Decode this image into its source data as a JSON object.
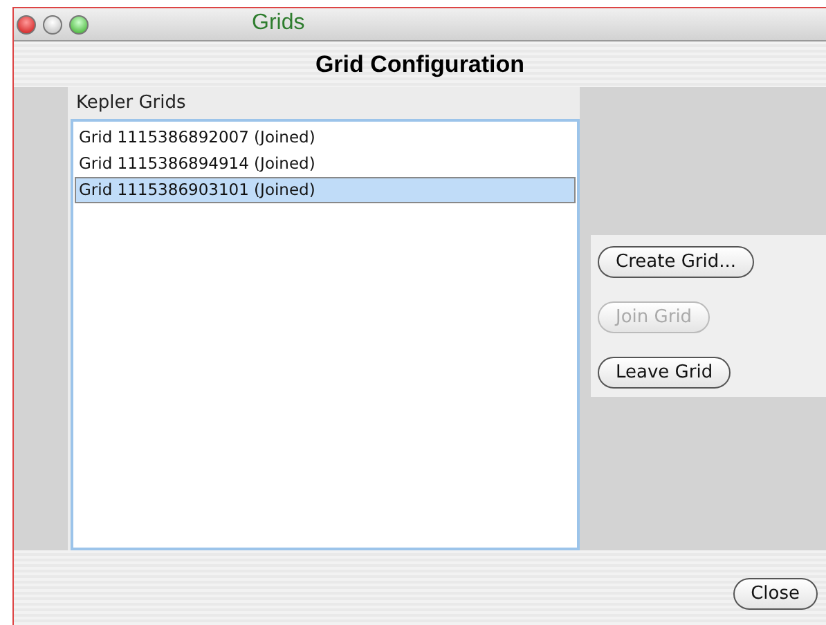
{
  "background_text": "Grids",
  "window": {
    "title": "Grid Configuration"
  },
  "list": {
    "heading": "Kepler Grids",
    "items": [
      {
        "label": "Grid 1115386892007 (Joined)",
        "selected": false
      },
      {
        "label": "Grid 1115386894914 (Joined)",
        "selected": false
      },
      {
        "label": "Grid 1115386903101 (Joined)",
        "selected": true
      }
    ]
  },
  "actions": [
    {
      "label": "Create Grid...",
      "disabled": false
    },
    {
      "label": "Join Grid",
      "disabled": true
    },
    {
      "label": "Leave Grid",
      "disabled": false
    }
  ],
  "buttons": [
    {
      "label": "Close"
    }
  ]
}
